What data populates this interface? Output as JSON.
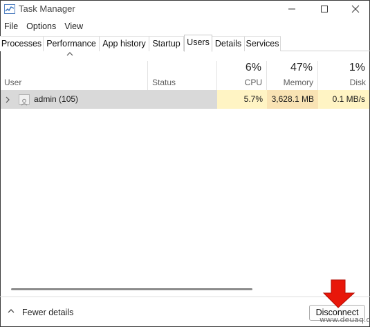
{
  "window": {
    "title": "Task Manager"
  },
  "menu": [
    "File",
    "Options",
    "View"
  ],
  "tabs": [
    "Processes",
    "Performance",
    "App history",
    "Startup",
    "Users",
    "Details",
    "Services"
  ],
  "active_tab": "Users",
  "columns": {
    "user": "User",
    "status": "Status",
    "cpu": {
      "percent": "6%",
      "label": "CPU"
    },
    "memory": {
      "percent": "47%",
      "label": "Memory"
    },
    "disk": {
      "percent": "1%",
      "label": "Disk"
    }
  },
  "rows": [
    {
      "user": "admin (105)",
      "status": "",
      "cpu": "5.7%",
      "memory": "3,628.1 MB",
      "disk": "0.1 MB/s"
    }
  ],
  "footer": {
    "fewer_details": "Fewer details",
    "disconnect": "Disconnect"
  },
  "watermark": "www.deuaq.com",
  "colors": {
    "cpu_heat": "#fff4c4",
    "memory_heat": "#f9e3b4",
    "row_highlight": "#d9d9d9",
    "arrow": "#e8170a"
  },
  "icons": [
    "task-manager-app-icon",
    "minimize-icon",
    "maximize-icon",
    "close-icon",
    "sort-ascending-icon",
    "expand-chevron-icon",
    "user-icon",
    "chevron-up-icon",
    "red-arrow-down-icon"
  ]
}
